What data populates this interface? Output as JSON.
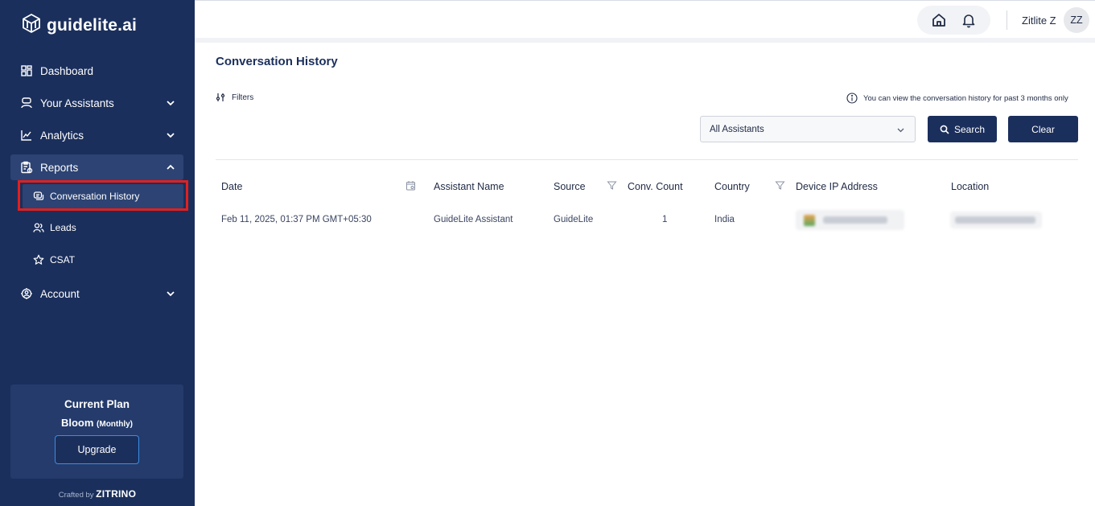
{
  "brand": {
    "name": "guidelite.ai"
  },
  "sidebar": {
    "items": [
      {
        "label": "Dashboard",
        "icon": "dashboard-icon"
      },
      {
        "label": "Your Assistants",
        "icon": "assistant-icon"
      },
      {
        "label": "Analytics",
        "icon": "analytics-icon"
      },
      {
        "label": "Reports",
        "icon": "reports-icon",
        "expanded": true
      },
      {
        "label": "Account",
        "icon": "account-gear-icon"
      }
    ],
    "reports_sub": [
      {
        "label": "Conversation History",
        "icon": "chat-icon",
        "selected": true
      },
      {
        "label": "Leads",
        "icon": "users-icon"
      },
      {
        "label": "CSAT",
        "icon": "star-icon"
      }
    ],
    "plan": {
      "title": "Current Plan",
      "name": "Bloom",
      "cycle": "(Monthly)",
      "upgrade_label": "Upgrade"
    },
    "crafted_prefix": "Crafted by",
    "crafted_brand": "ZITRINO"
  },
  "topbar": {
    "user_name": "Zitlite Z",
    "avatar_initials": "ZZ"
  },
  "main": {
    "title": "Conversation History",
    "filters_label": "Filters",
    "info_note": "You can view the conversation history for past 3 months only",
    "assistant_select": "All Assistants",
    "search_label": "Search",
    "clear_label": "Clear"
  },
  "table": {
    "columns": [
      "Date",
      "Assistant Name",
      "Source",
      "Conv. Count",
      "Country",
      "Device IP Address",
      "Location"
    ],
    "rows": [
      {
        "date": "Feb 11, 2025, 01:37 PM GMT+05:30",
        "assistant": "GuideLite Assistant",
        "source": "GuideLite",
        "count": "1",
        "country": "India"
      }
    ]
  },
  "colors": {
    "sidebar_bg": "#1b2f5c",
    "accent": "#1b2f5c",
    "highlight": "#e0201f"
  }
}
